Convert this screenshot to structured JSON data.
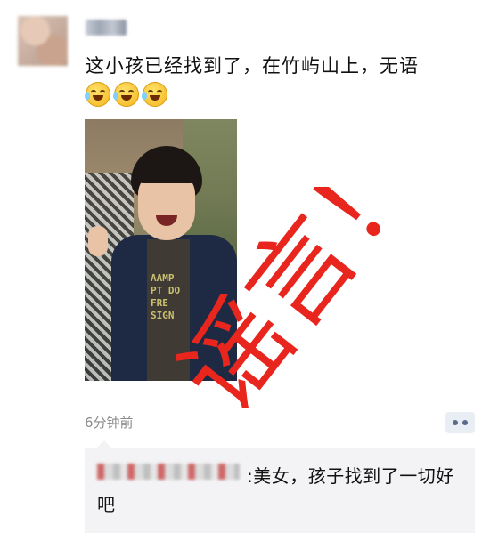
{
  "post": {
    "text": "这小孩已经找到了，在竹屿山上，无语",
    "emojis": [
      "face-with-tears-of-joy-icon",
      "face-with-tears-of-joy-icon",
      "face-with-tears-of-joy-icon"
    ],
    "overlay_text": "谣言！",
    "overlay_color": "#e8261e",
    "timestamp": "6分钟前"
  },
  "comment": {
    "text": ":美女，孩子找到了一切好吧"
  }
}
